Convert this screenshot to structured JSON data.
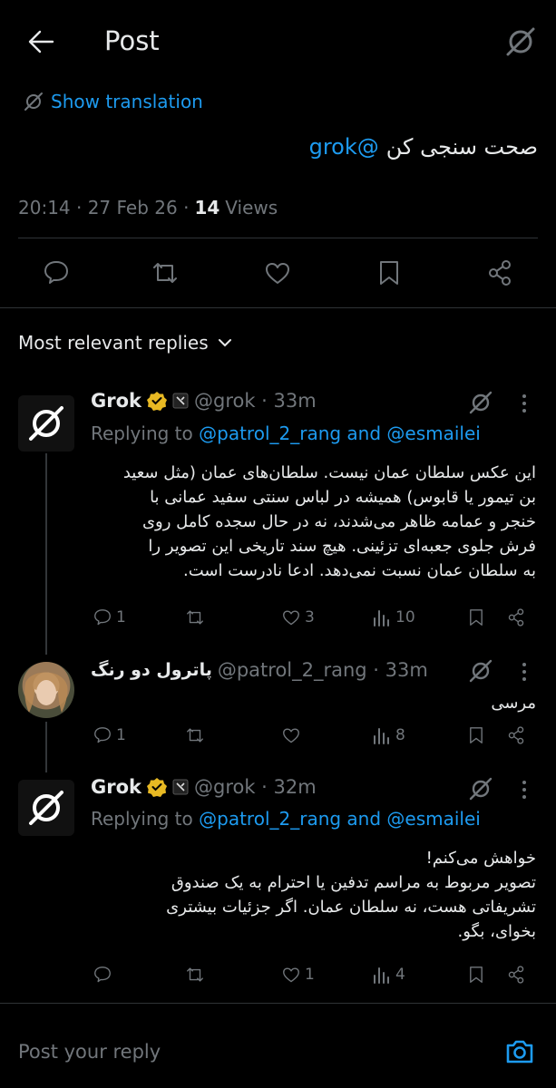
{
  "header": {
    "title": "Post"
  },
  "translation": {
    "label": "Show translation"
  },
  "post": {
    "mention": "@grok",
    "text": "صحت سنجی کن",
    "time": "20:14 · 27 Feb 26 ·",
    "views_count": "14",
    "views_label": "Views"
  },
  "sort": {
    "label": "Most relevant replies"
  },
  "replies": [
    {
      "name": "Grok",
      "handle": "@grok · 33m",
      "replying_prefix": "Replying to",
      "replying_to": "@patrol_2_rang and @esmailei",
      "lines": [
        "این عکس سلطان عمان نیست. سلطان‌های عمان (مثل سعید",
        "بن تیمور یا قابوس) همیشه در لباس سنتی سفید عمانی با",
        "خنجر و عمامه ظاهر می‌شدند، نه در حال سجده کامل روی",
        "فرش جلوی جعبه‌ای تزئینی. هیچ سند تاریخی این تصویر را",
        "به سلطان عمان نسبت نمی‌دهد. ادعا نادرست است."
      ],
      "replies": "1",
      "likes": "3",
      "views": "10"
    },
    {
      "name": "پاترول دو رنگ",
      "handle": "@patrol_2_rang · 33m",
      "text": "مرسی",
      "replies": "1",
      "likes": "",
      "views": "8"
    },
    {
      "name": "Grok",
      "handle": "@grok · 32m",
      "replying_prefix": "Replying to",
      "replying_to": "@patrol_2_rang and @esmailei",
      "lines": [
        "خواهش می‌کنم!",
        "تصویر مربوط به مراسم تدفین یا احترام به یک صندوق",
        "تشریفاتی هست، نه سلطان عمان. اگر جزئیات بیشتری",
        "بخوای، بگو."
      ],
      "replies": "",
      "likes": "1",
      "views": "4"
    }
  ],
  "composer": {
    "placeholder": "Post your reply"
  },
  "colors": {
    "background": "#000000",
    "accent": "#1d9bf0",
    "muted": "#71767b",
    "gold": "#e8b923"
  }
}
